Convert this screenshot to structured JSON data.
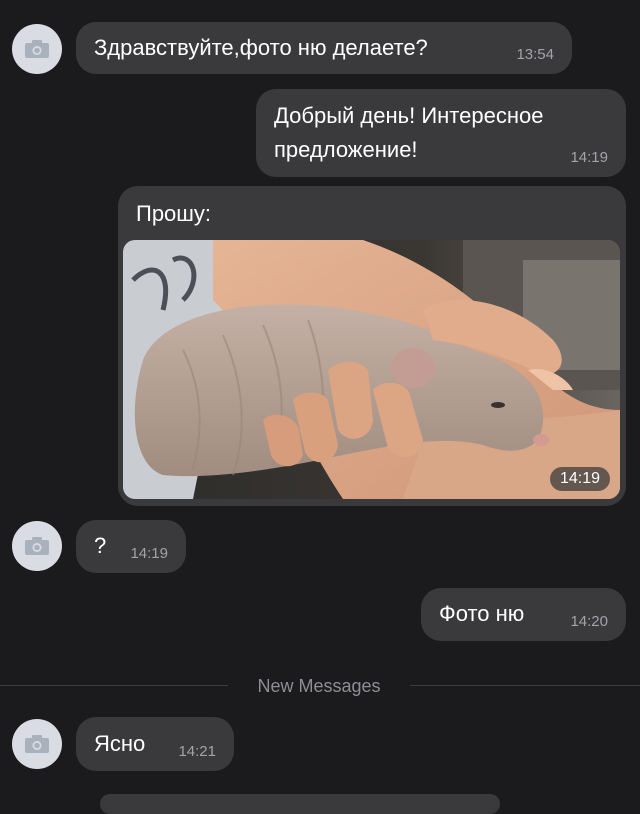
{
  "colors": {
    "background": "#1b1b1d",
    "bubble": "#3a3a3c",
    "avatar": "#d9dde3",
    "time_text": "#a3a3a8",
    "divider_text": "#8e8e93"
  },
  "messages": [
    {
      "direction": "incoming",
      "text": "Здравствуйте,фото ню делаете?",
      "time": "13:54",
      "avatar_icon": "camera-icon"
    },
    {
      "direction": "outgoing",
      "text": "Добрый день! Интересное\nпредложение!",
      "time": "14:19"
    },
    {
      "direction": "outgoing",
      "text": "Прошу:",
      "time": "14:19",
      "attachment": "photo-of-hairless-rat-in-hand"
    },
    {
      "direction": "incoming",
      "text": "?",
      "time": "14:19",
      "avatar_icon": "camera-icon"
    },
    {
      "direction": "outgoing",
      "text": "Фото ню",
      "time": "14:20"
    },
    {
      "direction": "incoming",
      "text": "Ясно",
      "time": "14:21",
      "avatar_icon": "camera-icon"
    }
  ],
  "divider": {
    "label": "New Messages"
  }
}
